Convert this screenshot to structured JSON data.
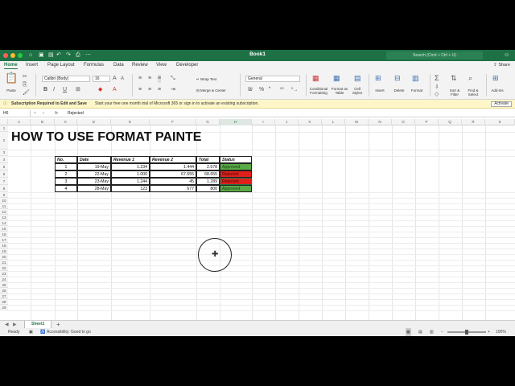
{
  "window": {
    "title": "Book1",
    "search_placeholder": "Search (Cmd + Ctrl + U)"
  },
  "tabs": [
    "Home",
    "Insert",
    "Page Layout",
    "Formulas",
    "Data",
    "Review",
    "View",
    "Developer"
  ],
  "share_label": "Share",
  "ribbon": {
    "paste": "Paste",
    "font_name": "Calibri (Body)",
    "font_size": "16",
    "wrap_text": "Wrap Text",
    "merge_center": "Merge & Center",
    "number_format": "General",
    "conditional_formatting": "Conditional Formatting",
    "format_as_table": "Format as Table",
    "cell_styles": "Cell Styles",
    "insert": "Insert",
    "delete": "Delete",
    "format": "Format",
    "sort_filter": "Sort & Filter",
    "find_select": "Find & Select",
    "add_ins": "Add-ins"
  },
  "notice": {
    "title": "Subscription Required to Edit and Save",
    "message": "Start your free one month trial of Microsoft 365 or sign in to activate an existing subscription.",
    "button": "Activate"
  },
  "formula_bar": {
    "name_box": "H6",
    "fx": "fx",
    "value": "Rejected"
  },
  "columns": [
    "A",
    "B",
    "C",
    "D",
    "E",
    "F",
    "G",
    "H",
    "I",
    "J",
    "K",
    "L",
    "M",
    "N",
    "O",
    "P",
    "Q",
    "R",
    "S"
  ],
  "rows": [
    "1",
    "2",
    "3",
    "4",
    "5",
    "6",
    "7",
    "8",
    "9",
    "10",
    "11",
    "12",
    "13",
    "14",
    "15",
    "16",
    "17",
    "18",
    "19",
    "20",
    "21",
    "22",
    "23",
    "24",
    "25",
    "26",
    "27",
    "28",
    "29"
  ],
  "sheet_title": "HOW TO USE FORMAT PAINTE",
  "table": {
    "headers": [
      "No.",
      "Date",
      "Revenue 1",
      "Revenue 2",
      "Total",
      "Status"
    ],
    "rows": [
      {
        "no": "1",
        "date": "19-May",
        "rev1": "1.234",
        "rev2": "1.444",
        "total": "2.678",
        "status": "Approved",
        "status_color": "#5aaa46"
      },
      {
        "no": "2",
        "date": "22-May",
        "rev1": "1.000",
        "rev2": "67.655",
        "total": "68.655",
        "status": "Rejected",
        "status_color": "#e0201b"
      },
      {
        "no": "3",
        "date": "23-May",
        "rev1": "1.244",
        "rev2": "45",
        "total": "1.289",
        "status": "Rejected",
        "status_color": "#e0201b"
      },
      {
        "no": "4",
        "date": "28-May",
        "rev1": "123",
        "rev2": "677",
        "total": "800",
        "status": "Approved",
        "status_color": "#5aaa46"
      }
    ]
  },
  "sheet_tab": "Sheet1",
  "status": {
    "ready": "Ready",
    "accessibility": "Accessibility: Good to go",
    "zoom": "100%"
  },
  "colors": {
    "brand": "#1e7145",
    "approved": "#5aaa46",
    "rejected": "#e0201b"
  }
}
